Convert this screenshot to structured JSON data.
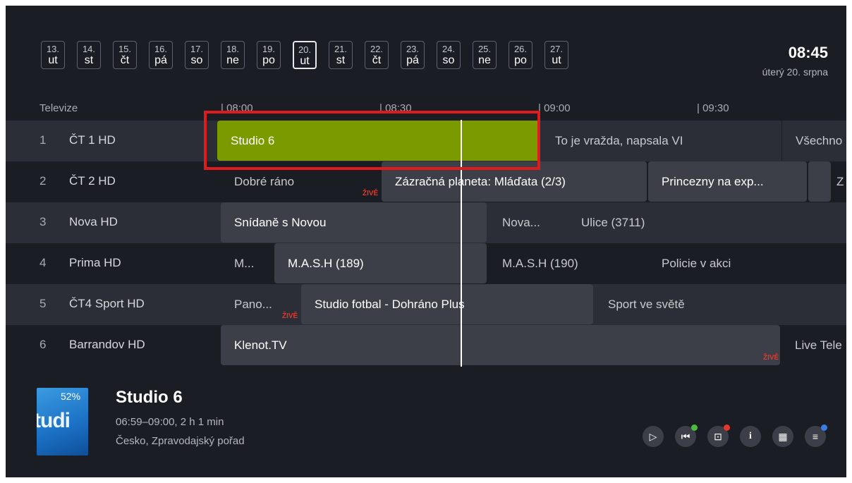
{
  "dates": [
    {
      "d": "13.",
      "w": "ut"
    },
    {
      "d": "14.",
      "w": "st"
    },
    {
      "d": "15.",
      "w": "čt"
    },
    {
      "d": "16.",
      "w": "pá"
    },
    {
      "d": "17.",
      "w": "so"
    },
    {
      "d": "18.",
      "w": "ne"
    },
    {
      "d": "19.",
      "w": "po"
    },
    {
      "d": "20.",
      "w": "ut"
    },
    {
      "d": "21.",
      "w": "st"
    },
    {
      "d": "22.",
      "w": "čt"
    },
    {
      "d": "23.",
      "w": "pá"
    },
    {
      "d": "24.",
      "w": "so"
    },
    {
      "d": "25.",
      "w": "ne"
    },
    {
      "d": "26.",
      "w": "po"
    },
    {
      "d": "27.",
      "w": "ut"
    }
  ],
  "clock": {
    "time": "08:45",
    "date": "úterý 20. srpna"
  },
  "timeline": {
    "section": "Televize",
    "t1": "| 08:00",
    "t2": "| 08:30",
    "t3": "| 09:00",
    "t4": "| 09:30"
  },
  "channels": [
    {
      "num": "1",
      "name": "ČT 1 HD",
      "p1": "Studio 6",
      "p2": "To je vražda, napsala VI",
      "p3": "Všechno"
    },
    {
      "num": "2",
      "name": "ČT 2 HD",
      "p1": "Dobré ráno",
      "live": "ŽIVĚ",
      "p2": "Zázračná planeta: Mláďata (2/3)",
      "p3": "Princezny na exp...",
      "p4": "Z"
    },
    {
      "num": "3",
      "name": "Nova HD",
      "p1": "Snídaně s Novou",
      "p2": "Nova...",
      "p3": "Ulice (3711)"
    },
    {
      "num": "4",
      "name": "Prima HD",
      "p1": "M...",
      "p2": "M.A.S.H (189)",
      "p3": "M.A.S.H (190)",
      "p4": "Policie v akci"
    },
    {
      "num": "5",
      "name": "ČT4 Sport HD",
      "p1": "Pano...",
      "live": "ŽIVĚ",
      "p2": "Studio fotbal - Dohráno Plus",
      "p3": "Sport ve světě"
    },
    {
      "num": "6",
      "name": "Barrandov HD",
      "p1": "Klenot.TV",
      "live": "ŽIVĚ",
      "p2": "Live Tele"
    }
  ],
  "detail": {
    "progress_pct": "52%",
    "thumb_text": "tudi",
    "title": "Studio 6",
    "time": "06:59–09:00, 2 h 1 min",
    "genre": "Česko, Zpravodajský pořad"
  },
  "controls": {
    "play": "▷",
    "restart": "⏮",
    "record": "⊡",
    "info": "i",
    "calendar": "▦",
    "menu": "≡"
  },
  "colors": {
    "active": "#7a9a00",
    "live": "#e0392a",
    "dot_green": "#4cbb40",
    "dot_red": "#e0392a",
    "dot_blue": "#3b7de0"
  }
}
